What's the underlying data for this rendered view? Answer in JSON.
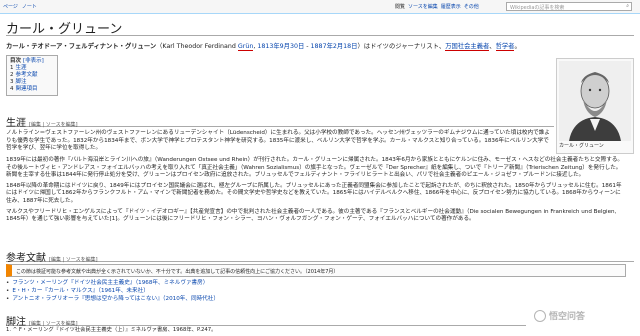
{
  "tabs": [
    "ページ",
    "ノート"
  ],
  "actions": [
    "閲覧",
    "ソースを編集",
    "履歴表示",
    "その他"
  ],
  "search_placeholder": "Wikipediaの記事を検索",
  "title": "カール・グリューン",
  "lead": {
    "bold": "カール・テオドーア・フェルディナント・グリューン",
    "p1": "（Karl Theodor Ferdinand ",
    "grun": "Grün",
    "p2": ", ",
    "born": "1813年9月30日",
    "p3": " - ",
    "died": "1887年2月18日",
    "p4": "）はドイツのジャーナリスト、",
    "link1": "万国社会主義者",
    "p5": "、",
    "link2": "哲学者",
    "p6": "。"
  },
  "toc": {
    "title": "目次",
    "hide": "[非表示]",
    "items": [
      {
        "n": "1",
        "label": "生涯"
      },
      {
        "n": "2",
        "label": "参考文献"
      },
      {
        "n": "3",
        "label": "脚注"
      },
      {
        "n": "4",
        "label": "関連項目"
      }
    ]
  },
  "portrait_caption": "カール・グリューン",
  "sections": {
    "life": {
      "title": "生涯",
      "edit": "[編集 | ソースを編集]",
      "p1": "ノルトライン＝ヴェストファーレン州のヴェストファーレンにあるリューデンシャイト（Lüdenscheid）に生まれる。父は小学校の教師であった。ヘッセン州ヴェッツラーのギムナジウムに通っていた頃は校内で誰よりも優秀な学生であった。1832年から1834年まで、ボン大学で神学とプロテスタント神学を研究する。1835年に渡米し、ベルリン大学で哲学を学ぶ。カール・マルクスと知り合っている。1836年にベルリン大学で哲学を学び、翌年に学位を取得した。",
      "p2": "1839年には最初の著作『バルト海沿岸とライン川への旅』（Wanderungen Ostsee und Rhein）が刊行された。カール・グリューンに帰属された。1843年6月から家族とともにケルンに住み、モーゼス・ヘスなどの社会主義者たちと交際する。その後ルートヴィヒ・アンドレアス・フォイエルバッハの考えを取り入れて「真正社会主義」（Wahren Sozialismus）の旗手となった。ヴェーゼルで『Der Sprecher』紙を編集し、ついで『トリーア新聞』（Trierischen Zeitung）を発行した。新聞を主宰する仕事は1844年に発行停止処分を受け、グリューンはプロイセン政府に追放された。ブリュッセルでフェルディナント・フライリヒラートと出会い、パリで社会主義者のピエール・ジョゼフ・プルードンに接近した。",
      "p3": "1848年以降の革命期にはドイツに戻り、1849年にはプロイセン国民議会に選ばれ、極左グループに所属した。ブリュッセルにあった正義者同盟集会に参加したことで起訴されたが、のちに釈放された。1850年からブリュッセルに住む。1861年にはドイツに帰国して1862年からフランクフルト・アム・マインで新聞記者を務めた。その間文学史や哲学史などを教えていた。1865年にはハイデルベルクへ移住、1866年を中心に、反プロイセン勢力に協力している。1868年からウィーンに住み、1887年に死去した。",
      "p4": "マルクスやフリードリヒ・エンゲルスによって『ドイツ・イデオロギー』【共産党宣言】の中で批判された社会主義者の一人である。彼の主著である『フランスとベルギーの社会運動』（Die socialen Bewegungen in Frankreich und Belgien, 1845年）を通じて強い影響を与えていた[1]。グリューンには後にフリードリヒ・フォン・シラー、ヨハン・ヴォルフガング・フォン・ゲーテ、フォイエルバッハについての著作がある。"
    },
    "refs": {
      "title": "参考文献",
      "edit": "[編集 | ソースを編集]",
      "notice": "この節は検証可能な参考文献や出典が全く示されていないか、不十分です。出典を追加して記事の信頼性向上にご協力ください。（2014年7月）",
      "items": [
        "フランツ・メーリング『ドイツ社会民主主義史』（1968年、ミネルヴァ書房）",
        "E・H・カー『カール・マルクス』（1961年、未来社）",
        "アントニオ・ラブリオーラ『思想は空から降ってはこない』（2010年、同時代社）"
      ]
    },
    "notes": {
      "title": "脚注",
      "edit": "[編集 | ソースを編集]",
      "items": [
        "1. ^ F・メーリング『ドイツ社会民主主義史（上）』ミネルヴァ書房、1968年、P.247。"
      ]
    }
  },
  "watermark": "悟空问答",
  "colors": {
    "link": "#0645ad",
    "notice": "#f28500",
    "underline": "#c00000"
  }
}
